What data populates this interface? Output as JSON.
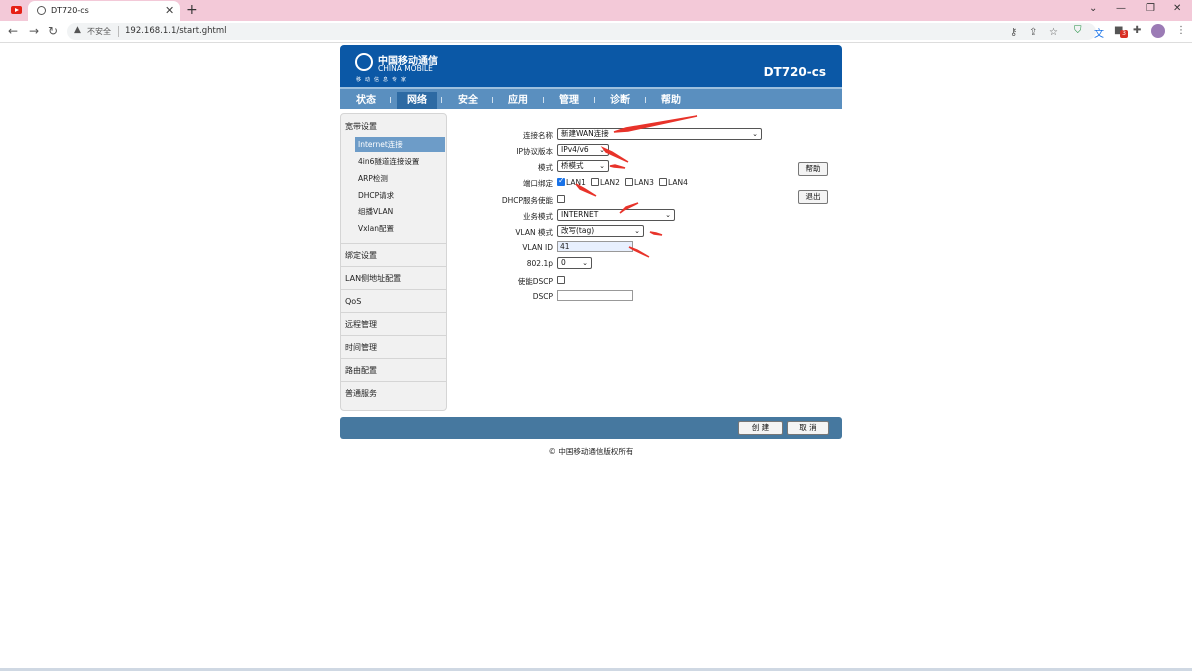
{
  "browser": {
    "tab_title": "DT720-cs",
    "tab_close": "✕",
    "new_tab": "+",
    "security_label": "不安全",
    "url": "192.168.1.1/start.ghtml",
    "extension_badge": "3"
  },
  "header": {
    "logo_cn": "中国移动通信",
    "logo_en": "CHINA MOBILE",
    "logo_sub": "移动信息专家",
    "model": "DT720-cs",
    "brand_color": "#0b58a6"
  },
  "nav": {
    "items": [
      "状态",
      "网络",
      "安全",
      "应用",
      "管理",
      "诊断",
      "帮助"
    ],
    "active": "网络"
  },
  "sidebar": {
    "section_title": "宽带设置",
    "sub_items": [
      "Internet连接",
      "4in6隧道连接设置",
      "ARP检测",
      "DHCP请求",
      "组播VLAN",
      "Vxlan配置"
    ],
    "active_sub": "Internet连接",
    "sections": [
      "绑定设置",
      "LAN侧地址配置",
      "QoS",
      "远程管理",
      "时间管理",
      "路由配置",
      "普通服务"
    ]
  },
  "form": {
    "conn_name_label": "连接名称",
    "conn_name_value": "新建WAN连接",
    "ip_version_label": "IP协议版本",
    "ip_version_value": "IPv4/v6",
    "mode_label": "模式",
    "mode_value": "桥模式",
    "port_bind_label": "端口绑定",
    "ports": [
      {
        "label": "LAN1",
        "checked": true
      },
      {
        "label": "LAN2",
        "checked": false
      },
      {
        "label": "LAN3",
        "checked": false
      },
      {
        "label": "LAN4",
        "checked": false
      }
    ],
    "dhcp_label": "DHCP服务使能",
    "dhcp_checked": false,
    "service_mode_label": "业务模式",
    "service_mode_value": "INTERNET",
    "vlan_mode_label": "VLAN 模式",
    "vlan_mode_value": "改写(tag)",
    "vlan_id_label": "VLAN ID",
    "vlan_id_value": "41",
    "p8021_label": "802.1p",
    "p8021_value": "0",
    "enable_dscp_label": "使能DSCP",
    "enable_dscp_checked": false,
    "dscp_label": "DSCP",
    "dscp_value": ""
  },
  "side_buttons": {
    "help": "帮助",
    "logout": "退出"
  },
  "footer": {
    "create": "创 建",
    "cancel": "取 消",
    "copyright": "© 中国移动通信版权所有"
  },
  "annotation_color": "#e8332a"
}
